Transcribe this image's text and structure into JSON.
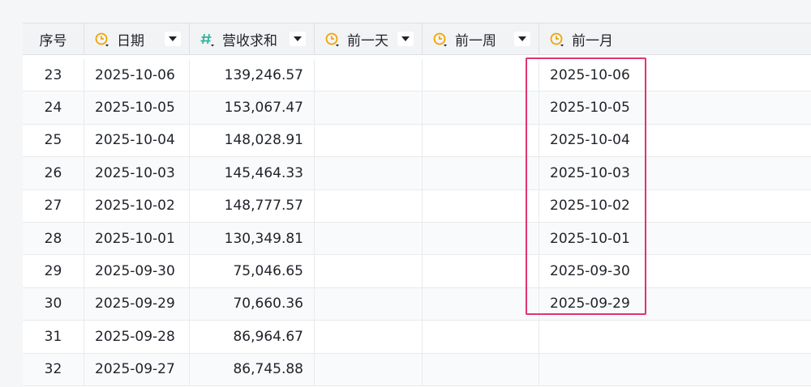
{
  "columns": {
    "seq": "序号",
    "date": "日期",
    "revenue": "营收求和",
    "prev_day": "前一天",
    "prev_week": "前一周",
    "prev_month": "前一月"
  },
  "colors": {
    "date_icon": "#f0a500",
    "number_icon": "#2fb59a",
    "highlight_border": "#e0346d"
  },
  "icons": {
    "date_field": "clock-icon",
    "number_field": "hash-icon",
    "dropdown": "caret-down-icon"
  },
  "rows": [
    {
      "seq": "23",
      "date": "2025-10-06",
      "revenue": "139,246.57",
      "prev_day": "",
      "prev_week": "",
      "prev_month": "2025-10-06"
    },
    {
      "seq": "24",
      "date": "2025-10-05",
      "revenue": "153,067.47",
      "prev_day": "",
      "prev_week": "",
      "prev_month": "2025-10-05"
    },
    {
      "seq": "25",
      "date": "2025-10-04",
      "revenue": "148,028.91",
      "prev_day": "",
      "prev_week": "",
      "prev_month": "2025-10-04"
    },
    {
      "seq": "26",
      "date": "2025-10-03",
      "revenue": "145,464.33",
      "prev_day": "",
      "prev_week": "",
      "prev_month": "2025-10-03"
    },
    {
      "seq": "27",
      "date": "2025-10-02",
      "revenue": "148,777.57",
      "prev_day": "",
      "prev_week": "",
      "prev_month": "2025-10-02"
    },
    {
      "seq": "28",
      "date": "2025-10-01",
      "revenue": "130,349.81",
      "prev_day": "",
      "prev_week": "",
      "prev_month": "2025-10-01"
    },
    {
      "seq": "29",
      "date": "2025-09-30",
      "revenue": "75,046.65",
      "prev_day": "",
      "prev_week": "",
      "prev_month": "2025-09-30"
    },
    {
      "seq": "30",
      "date": "2025-09-29",
      "revenue": "70,660.36",
      "prev_day": "",
      "prev_week": "",
      "prev_month": "2025-09-29"
    },
    {
      "seq": "31",
      "date": "2025-09-28",
      "revenue": "86,964.67",
      "prev_day": "",
      "prev_week": "",
      "prev_month": ""
    },
    {
      "seq": "32",
      "date": "2025-09-27",
      "revenue": "86,745.88",
      "prev_day": "",
      "prev_week": "",
      "prev_month": ""
    }
  ]
}
